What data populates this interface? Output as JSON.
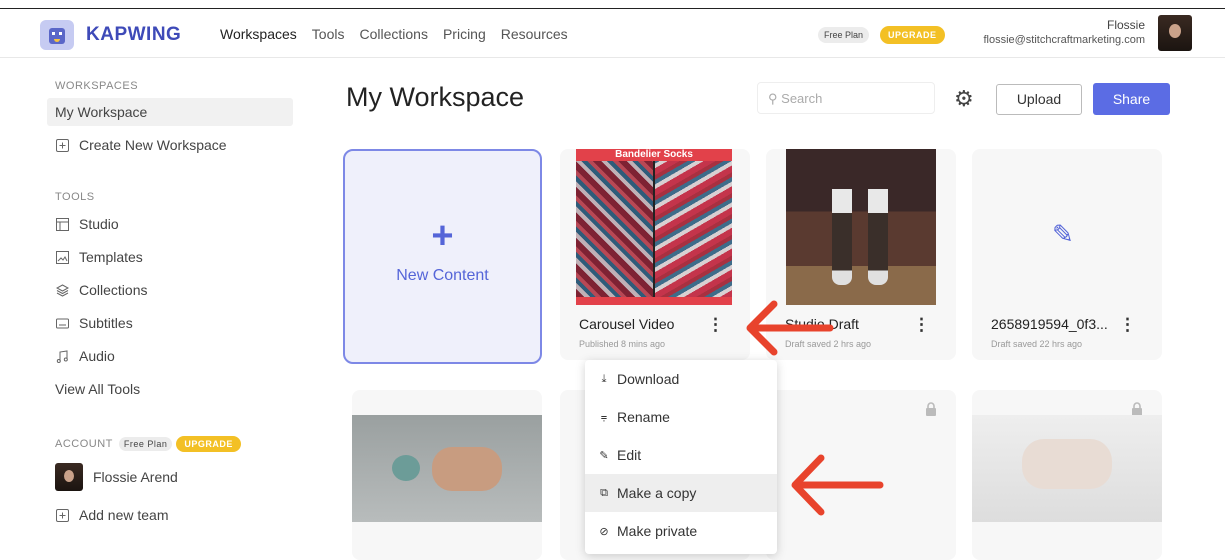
{
  "header": {
    "brand": "KAPWING",
    "nav": [
      "Workspaces",
      "Tools",
      "Collections",
      "Pricing",
      "Resources"
    ],
    "free_plan": "Free Plan",
    "upgrade": "UPGRADE",
    "user_name": "Flossie",
    "user_email": "flossie@stitchcraftmarketing.com"
  },
  "sidebar": {
    "workspaces_heading": "WORKSPACES",
    "my_workspace": "My Workspace",
    "create_workspace": "Create New Workspace",
    "tools_heading": "TOOLS",
    "tools": [
      "Studio",
      "Templates",
      "Collections",
      "Subtitles",
      "Audio"
    ],
    "view_all": "View All Tools",
    "account_heading": "ACCOUNT",
    "account_free_plan": "Free Plan",
    "account_upgrade": "UPGRADE",
    "account_user": "Flossie Arend",
    "add_team": "Add new team"
  },
  "main": {
    "title": "My Workspace",
    "search_placeholder": "Search",
    "upload_label": "Upload",
    "share_label": "Share",
    "new_content_label": "New Content",
    "cards": [
      {
        "name": "Carousel Video",
        "sub": "Published 8 mins ago",
        "thumb_banner": "Bandelier Socks"
      },
      {
        "name": "Studio Draft",
        "sub": "Draft saved 2 hrs ago"
      },
      {
        "name": "2658919594_0f3...",
        "sub": "Draft saved 22 hrs ago"
      }
    ]
  },
  "context_menu": {
    "items": [
      "Download",
      "Rename",
      "Edit",
      "Make a copy",
      "Make private"
    ],
    "highlighted": "Make a copy"
  },
  "colors": {
    "accent": "#5b6ce4",
    "upgrade": "#f3c025",
    "annotation_arrow": "#e8432c"
  }
}
